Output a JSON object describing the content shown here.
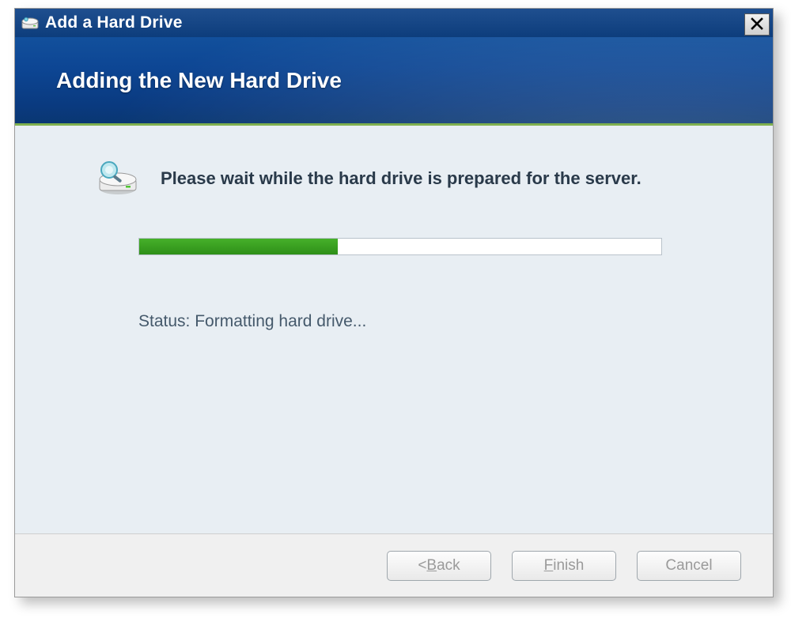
{
  "titlebar": {
    "title": "Add a Hard Drive"
  },
  "header": {
    "title": "Adding the New Hard Drive"
  },
  "content": {
    "message": "Please wait while the hard drive is prepared for the server.",
    "status_label": "Status: Formatting hard drive...",
    "progress_percent": 38
  },
  "footer": {
    "back_prefix": "< ",
    "back_u": "B",
    "back_rest": "ack",
    "finish_u": "F",
    "finish_rest": "inish",
    "cancel": "Cancel"
  },
  "colors": {
    "accent_green": "#2e8f18",
    "header_blue": "#0d4694"
  }
}
